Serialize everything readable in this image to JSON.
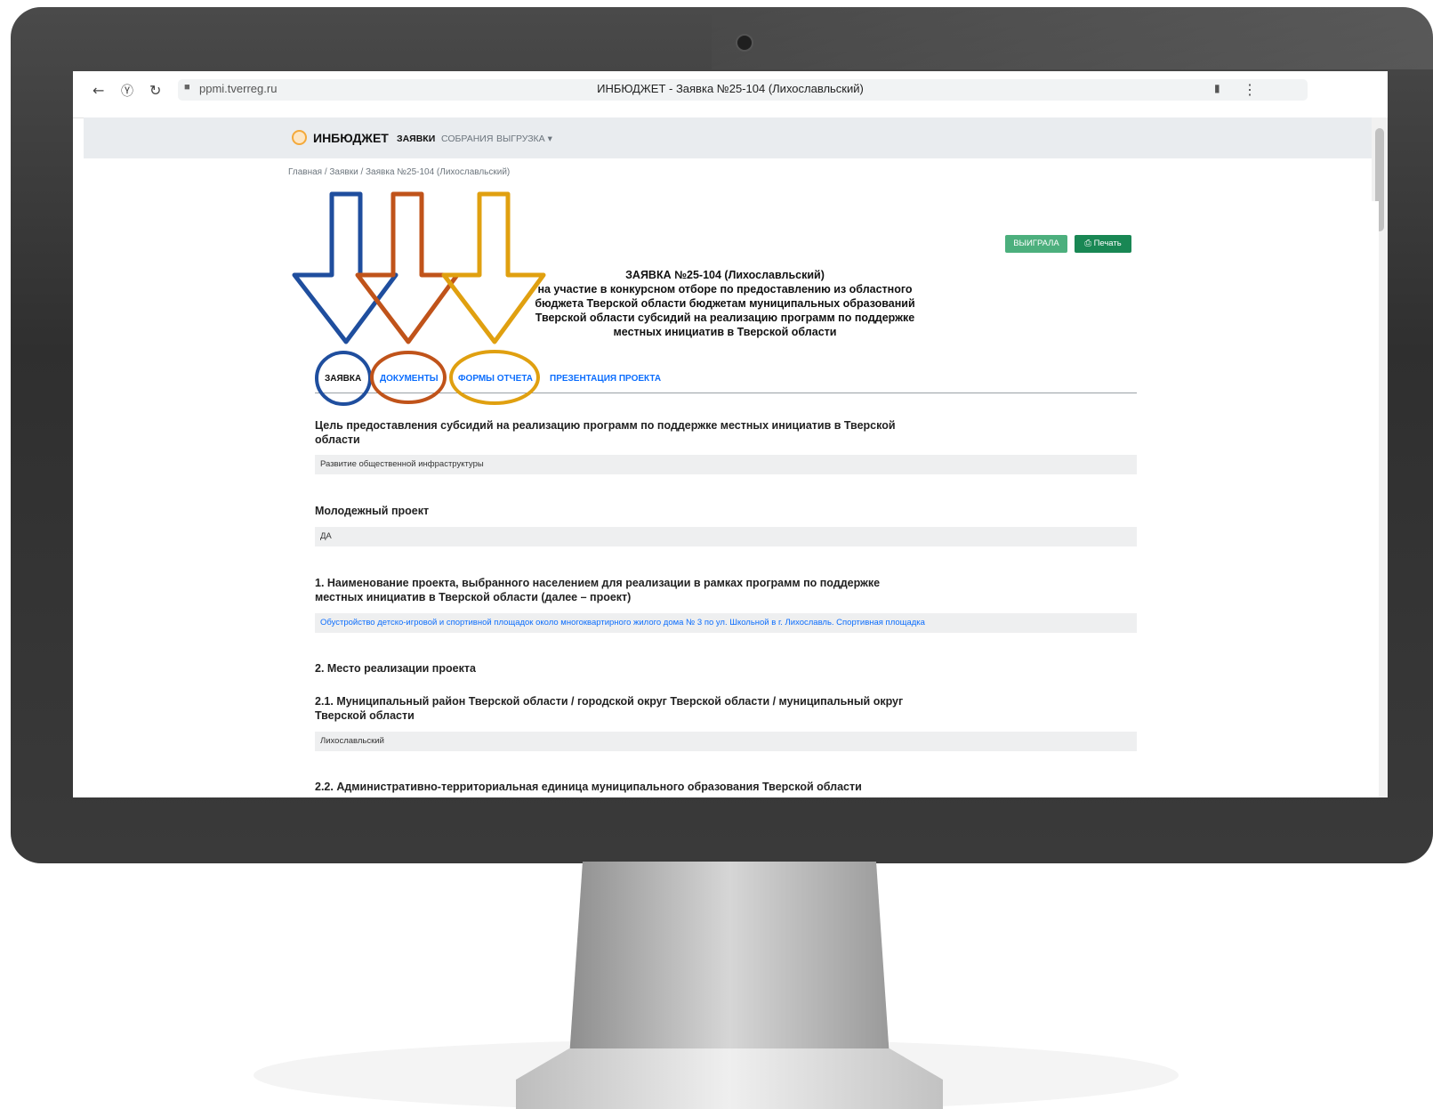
{
  "browser": {
    "url": "ppmi.tverreg.ru",
    "tab_title": "ИНБЮДЖЕТ - Заявка №25-104 (Лихославльский)",
    "icons": [
      "back-arrow-icon",
      "yandex-icon",
      "reload-icon",
      "lock-icon",
      "bookmark-icon",
      "more-icon"
    ]
  },
  "site": {
    "brand": "ИНБЮДЖЕТ",
    "nav": [
      "ЗАЯВКИ",
      "СОБРАНИЯ",
      "ВЫГРУЗКА"
    ],
    "breadcrumb": "Главная  /  Заявки  /  Заявка №25-104 (Лихославльский)"
  },
  "status": {
    "won_label": "ВЫИГРАЛА",
    "print_label": "Печать",
    "won_color": "#4caf7d",
    "print_color": "#198754"
  },
  "document": {
    "title": "ЗАЯВКА №25-104 (Лихославльский)",
    "subtitle_lines": [
      "на участие в конкурсном отборе по предоставлению из областного",
      "бюджета Тверской области бюджетам муниципальных образований",
      "Тверской области субсидий на реализацию программ по поддержке",
      "местных инициатив в Тверской области"
    ]
  },
  "tabs": [
    "ЗАЯВКА",
    "ДОКУМЕНТЫ",
    "ФОРМЫ ОТЧЕТА",
    "ПРЕЗЕНТАЦИЯ ПРОЕКТА"
  ],
  "annotation_colors": {
    "zayavka": "#1f4e9e",
    "dokumenty": "#c0531a",
    "formy": "#e0a010"
  },
  "sections": {
    "goal_heading_1": "Цель предоставления субсидий на реализацию программ по поддержке местных инициатив в Тверской",
    "goal_heading_2": "области",
    "goal_value": "Развитие общественной инфраструктуры",
    "youth_heading": "Молодежный проект",
    "youth_value": "ДА",
    "name_heading_1": "1. Наименование проекта, выбранного населением для реализации в рамках программ по поддержке",
    "name_heading_2": "местных инициатив в Тверской области (далее – проект)",
    "name_value": "Обустройство детско-игровой и спортивной площадок около многоквартирного жилого дома № 3 по ул. Школьной в г. Лихославль. Спортивная площадка",
    "place_heading": "2. Место реализации проекта",
    "district_heading_1": "2.1. Муниципальный район Тверской области / городской округ Тверской области / муниципальный округ",
    "district_heading_2": "Тверской области",
    "district_value": "Лихославльский",
    "unit_heading": "2.2. Административно-территориальная единица муниципального образования Тверской области"
  }
}
